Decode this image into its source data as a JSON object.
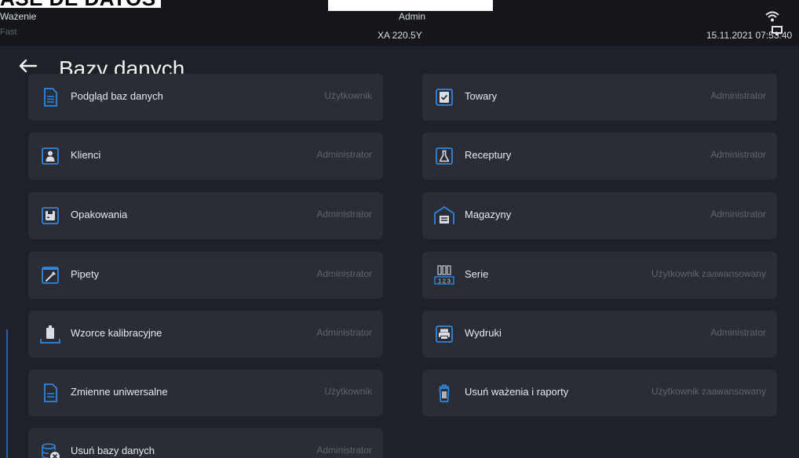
{
  "doc_heading": "ASE DE DATOS",
  "topbar": {
    "mode": "Ważenie",
    "profile": "Fast",
    "user": "Admin",
    "model": "XA 220.5Y",
    "datetime": "15.11.2021 07:53:40",
    "icons": [
      "wifi-icon",
      "monitor-icon"
    ]
  },
  "page": {
    "title": "Bazy danych",
    "back_icon": "arrow-left-icon"
  },
  "colors": {
    "background": "#1f2128",
    "tile": "#2a2d35",
    "icon_blue": "#2e86de",
    "text": "#e7e9ee",
    "role_text": "#5e6470"
  },
  "tiles": [
    {
      "label": "Podgląd baz danych",
      "role": "Użytkownik",
      "icon": "document-list-icon"
    },
    {
      "label": "Towary",
      "role": "Administrator",
      "icon": "product-box-icon"
    },
    {
      "label": "Klienci",
      "role": "Administrator",
      "icon": "person-icon"
    },
    {
      "label": "Receptury",
      "role": "Administrator",
      "icon": "flask-icon"
    },
    {
      "label": "Opakowania",
      "role": "Administrator",
      "icon": "package-icon"
    },
    {
      "label": "Magazyny",
      "role": "Administrator",
      "icon": "warehouse-icon"
    },
    {
      "label": "Pipety",
      "role": "Administrator",
      "icon": "pipette-icon"
    },
    {
      "label": "Serie",
      "role": "Użytkownik zaawansowany",
      "icon": "series-icon"
    },
    {
      "label": "Wzorce kalibracyjne",
      "role": "Administrator",
      "icon": "calibration-weight-icon"
    },
    {
      "label": "Wydruki",
      "role": "Administrator",
      "icon": "printer-icon"
    },
    {
      "label": "Zmienne uniwersalne",
      "role": "Użytkownik",
      "icon": "document-variables-icon"
    },
    {
      "label": "Usuń ważenia i raporty",
      "role": "Użytkownik zaawansowany",
      "icon": "trash-icon"
    },
    {
      "label": "Usuń bazy danych",
      "role": "Administrator",
      "icon": "delete-database-icon"
    }
  ]
}
